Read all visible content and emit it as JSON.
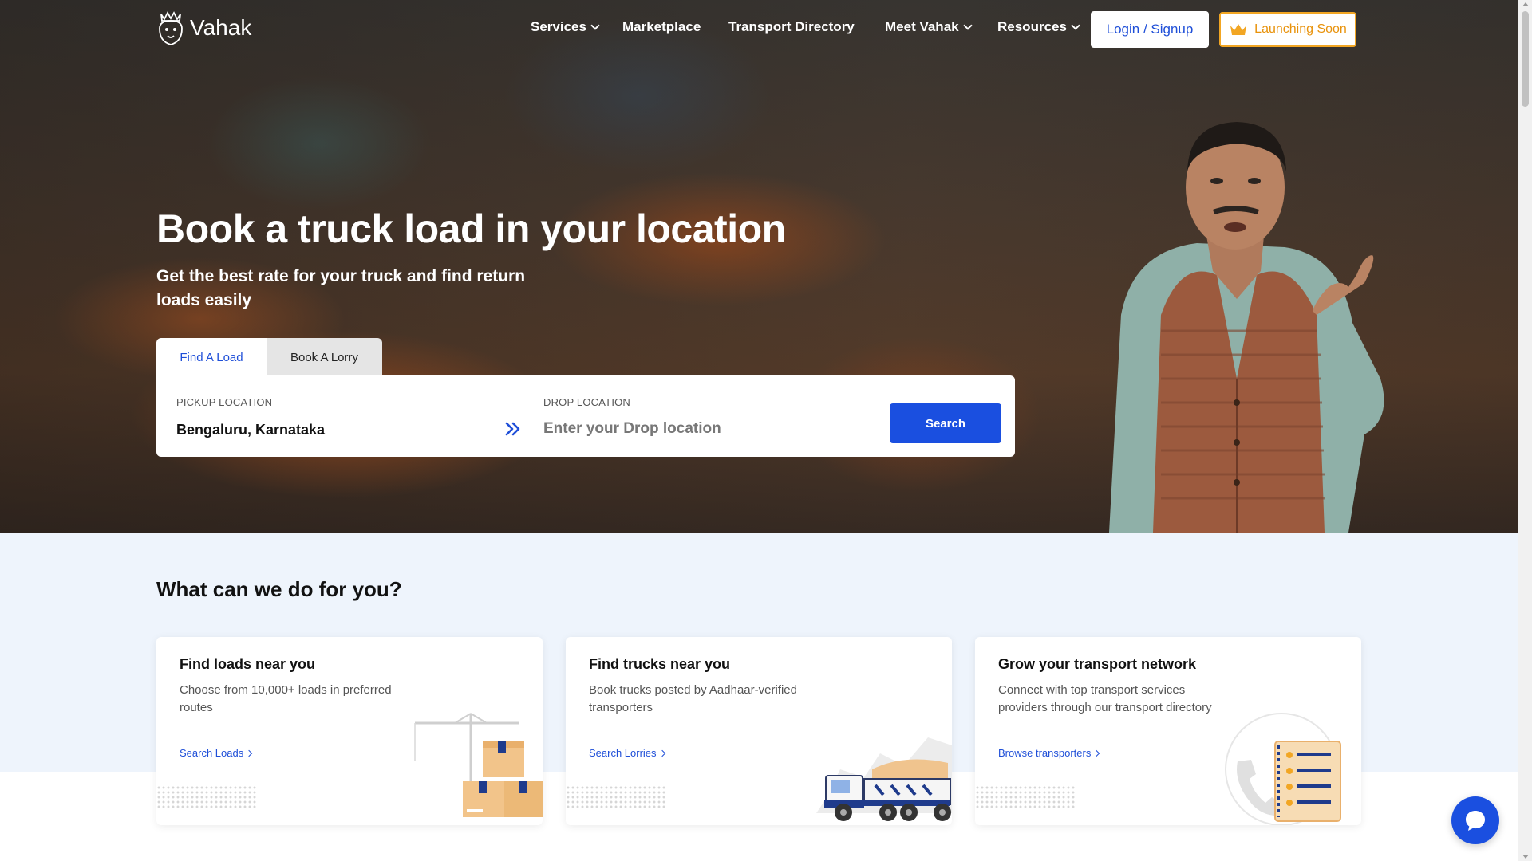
{
  "brand": {
    "name": "Vahak",
    "logo_icon": "lion-crown-icon"
  },
  "nav": {
    "items": [
      {
        "label": "Services",
        "has_dropdown": true
      },
      {
        "label": "Marketplace",
        "has_dropdown": false
      },
      {
        "label": "Transport Directory",
        "has_dropdown": false
      },
      {
        "label": "Meet Vahak",
        "has_dropdown": true
      },
      {
        "label": "Resources",
        "has_dropdown": true
      }
    ],
    "login_label": "Login / Signup",
    "launching_label": "Launching Soon",
    "launching_icon": "crown-icon"
  },
  "hero": {
    "title": "Book a truck load in your location",
    "subtitle": "Get the best rate for your truck and find return loads easily",
    "tabs": [
      {
        "label": "Find A Load",
        "active": true
      },
      {
        "label": "Book A Lorry",
        "active": false
      }
    ],
    "pickup": {
      "label": "PICKUP LOCATION",
      "value": "Bengaluru, Karnataka"
    },
    "drop": {
      "label": "DROP LOCATION",
      "placeholder": "Enter your Drop location",
      "value": ""
    },
    "search_label": "Search"
  },
  "services": {
    "title": "What can we do for you?",
    "cards": [
      {
        "title": "Find loads near you",
        "description": "Choose from 10,000+ loads in preferred routes",
        "link": "Search Loads",
        "illustration": "crane-boxes-illustration"
      },
      {
        "title": "Find trucks near you",
        "description": "Book trucks posted by Aadhaar-verified transporters",
        "link": "Search Lorries",
        "illustration": "truck-illustration"
      },
      {
        "title": "Grow your transport network",
        "description": "Connect with top transport services providers through our transport directory",
        "link": "Browse transporters",
        "illustration": "directory-phone-illustration"
      }
    ]
  },
  "colors": {
    "primary": "#1a4fe0",
    "accent": "#f2a623",
    "band": "#eef4fc"
  }
}
